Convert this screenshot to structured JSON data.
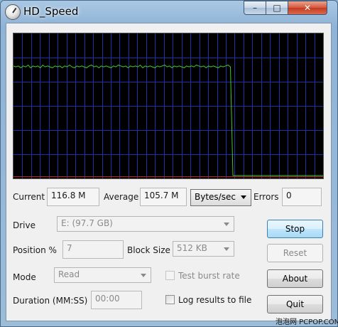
{
  "window": {
    "title": "HD_Speed",
    "controls": {
      "minimize": "–",
      "maximize": "□",
      "close": "✕"
    }
  },
  "graph": {
    "background": "#000000",
    "grid_color": "#1f2fa6",
    "trace_color": "#45c82a",
    "baseline_color": "#c81e1e",
    "y_range": [
      0,
      150
    ],
    "samples": [
      118,
      117,
      118,
      116,
      118,
      117,
      119,
      116,
      118,
      117,
      118,
      116,
      119,
      117,
      118,
      117,
      116,
      118,
      117,
      118,
      116,
      118,
      117,
      119,
      117,
      116,
      118,
      117,
      118,
      117,
      116,
      118,
      119,
      117,
      118,
      116,
      118,
      117,
      118,
      117,
      116,
      118,
      117,
      119,
      118,
      117,
      118,
      116,
      118,
      117,
      118,
      117,
      119,
      116,
      118,
      117,
      118,
      117,
      116,
      118,
      117,
      118,
      119,
      117,
      118,
      116,
      118,
      117,
      118,
      117,
      116,
      118,
      117,
      118,
      117,
      119,
      118,
      117,
      118,
      116,
      118,
      117,
      118,
      117,
      116,
      118,
      117,
      118,
      119,
      117,
      0,
      0,
      0,
      0,
      0,
      0,
      0,
      0,
      0,
      0,
      0,
      0,
      0,
      0,
      0,
      0,
      0,
      0,
      0,
      0,
      0,
      0,
      0,
      0,
      0,
      0,
      0,
      0,
      0,
      0,
      0,
      0,
      0,
      0,
      0,
      0,
      0,
      0
    ]
  },
  "stats": {
    "current_label": "Current",
    "current_value": "116.8 M",
    "average_label": "Average",
    "average_value": "105.7 M",
    "unit_selected": "Bytes/sec",
    "errors_label": "Errors",
    "errors_value": "0"
  },
  "settings": {
    "drive_label": "Drive",
    "drive_value": "E: (97.7 GB)",
    "position_label": "Position %",
    "position_value": "7",
    "block_size_label": "Block Size",
    "block_size_value": "512 KB",
    "mode_label": "Mode",
    "mode_value": "Read",
    "burst_label": "Test burst rate",
    "duration_label": "Duration (MM:SS)",
    "duration_value": "00:00",
    "log_label": "Log results to file"
  },
  "buttons": {
    "stop": "Stop",
    "reset": "Reset",
    "about": "About",
    "quit": "Quit"
  },
  "watermark": "泡泡网 PCPOP.COM"
}
